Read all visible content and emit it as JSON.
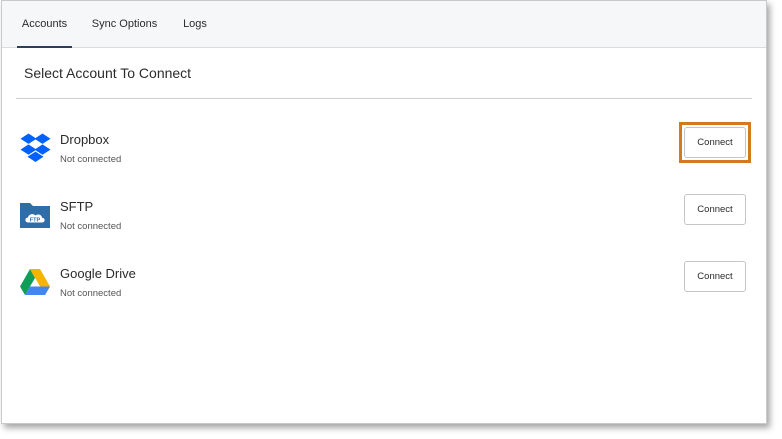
{
  "tabs": [
    {
      "label": "Accounts",
      "active": true
    },
    {
      "label": "Sync Options",
      "active": false
    },
    {
      "label": "Logs",
      "active": false
    }
  ],
  "section_title": "Select Account To Connect",
  "accounts": [
    {
      "name": "Dropbox",
      "status": "Not connected",
      "button_label": "Connect",
      "icon": "dropbox-icon",
      "highlighted": true
    },
    {
      "name": "SFTP",
      "status": "Not connected",
      "button_label": "Connect",
      "icon": "sftp-folder-icon",
      "highlighted": false
    },
    {
      "name": "Google Drive",
      "status": "Not connected",
      "button_label": "Connect",
      "icon": "google-drive-icon",
      "highlighted": false
    }
  ],
  "sftp_icon_text": "FTP",
  "colors": {
    "tab_active_underline": "#2a3f5c",
    "highlight_border": "#d17a22",
    "dropbox_blue": "#0061fe",
    "sftp_blue": "#2f6da8",
    "drive_green": "#0f9d58",
    "drive_yellow": "#f4b400",
    "drive_blue": "#4285f4"
  }
}
